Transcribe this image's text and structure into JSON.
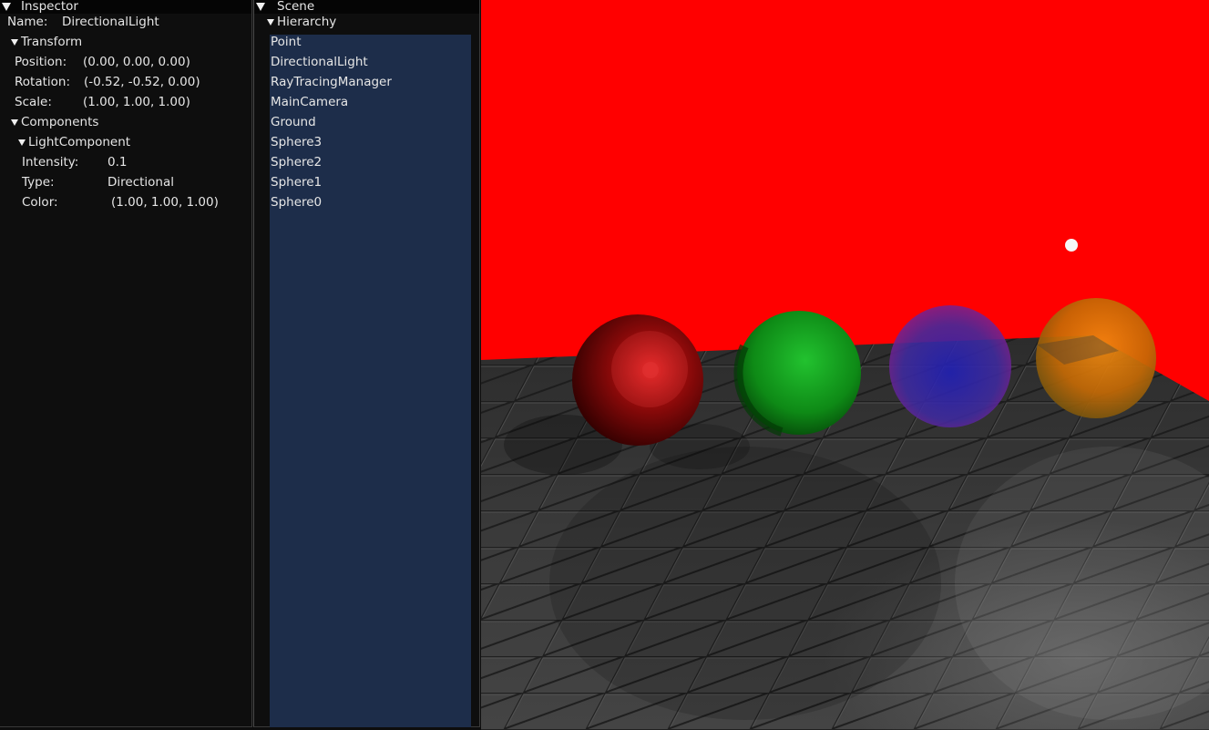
{
  "inspector": {
    "title": "Inspector",
    "name_label": "Name:",
    "name_value": "DirectionalLight",
    "transform": {
      "header": "Transform",
      "position_label": "Position:",
      "position_value": "(0.00, 0.00, 0.00)",
      "rotation_label": "Rotation:",
      "rotation_value": "(-0.52, -0.52, 0.00)",
      "scale_label": "Scale:",
      "scale_value": "(1.00, 1.00, 1.00)"
    },
    "components": {
      "header": "Components",
      "light": {
        "header": "LightComponent",
        "intensity_label": "Intensity:",
        "intensity_value": "0.1",
        "type_label": "Type:",
        "type_value": "Directional",
        "color_label": "Color:",
        "color_value": "(1.00, 1.00, 1.00)"
      }
    }
  },
  "scene": {
    "title": "Scene",
    "hierarchy_header": "Hierarchy",
    "items": [
      {
        "label": "Point"
      },
      {
        "label": "DirectionalLight"
      },
      {
        "label": "RayTracingManager"
      },
      {
        "label": "MainCamera"
      },
      {
        "label": "Ground"
      },
      {
        "label": "Sphere3"
      },
      {
        "label": "Sphere2"
      },
      {
        "label": "Sphere1"
      },
      {
        "label": "Sphere0"
      }
    ]
  },
  "viewport": {
    "background_color": "#ff0000",
    "sphere_colors": [
      "#b00000",
      "#0fa318",
      "#5a3aa8",
      "#d8700a"
    ]
  }
}
